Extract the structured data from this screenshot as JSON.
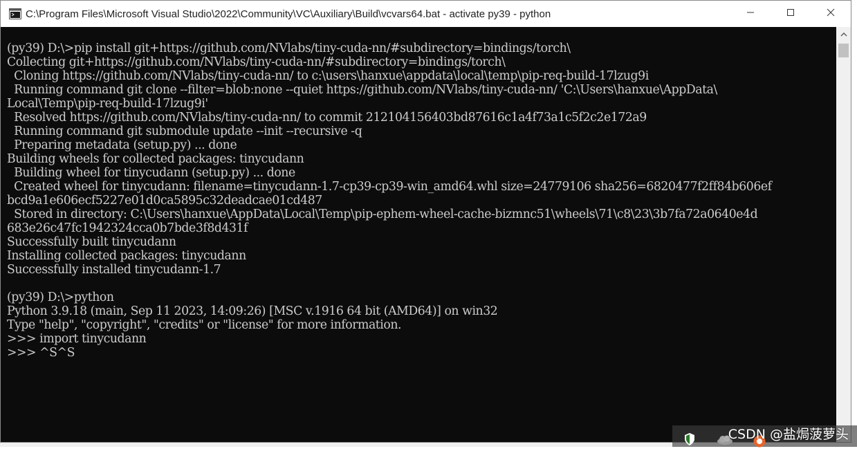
{
  "window": {
    "title": "C:\\Program Files\\Microsoft Visual Studio\\2022\\Community\\VC\\Auxiliary\\Build\\vcvars64.bat - activate  py39 - python",
    "icons": {
      "app": "console-icon",
      "minimize": "minimize-icon",
      "maximize": "maximize-icon",
      "close": "close-icon"
    }
  },
  "console": {
    "lines": [
      "(py39) D:\\>pip install git+https://github.com/NVlabs/tiny-cuda-nn/#subdirectory=bindings/torch\\",
      "Collecting git+https://github.com/NVlabs/tiny-cuda-nn/#subdirectory=bindings/torch\\",
      "  Cloning https://github.com/NVlabs/tiny-cuda-nn/ to c:\\users\\hanxue\\appdata\\local\\temp\\pip-req-build-17lzug9i",
      "  Running command git clone --filter=blob:none --quiet https://github.com/NVlabs/tiny-cuda-nn/ 'C:\\Users\\hanxue\\AppData\\",
      "Local\\Temp\\pip-req-build-17lzug9i'",
      "  Resolved https://github.com/NVlabs/tiny-cuda-nn/ to commit 212104156403bd87616c1a4f73a1c5f2c2e172a9",
      "  Running command git submodule update --init --recursive -q",
      "  Preparing metadata (setup.py) ... done",
      "Building wheels for collected packages: tinycudann",
      "  Building wheel for tinycudann (setup.py) ... done",
      "  Created wheel for tinycudann: filename=tinycudann-1.7-cp39-cp39-win_amd64.whl size=24779106 sha256=6820477f2ff84b606ef",
      "bcd9a1e606ecf5227e01d0ca5895c32deadcae01cd487",
      "  Stored in directory: C:\\Users\\hanxue\\AppData\\Local\\Temp\\pip-ephem-wheel-cache-bizmnc51\\wheels\\71\\c8\\23\\3b7fa72a0640e4d",
      "683e26c47fc1942324cca0b7bde3f8d431f",
      "Successfully built tinycudann",
      "Installing collected packages: tinycudann",
      "Successfully installed tinycudann-1.7",
      "",
      "(py39) D:\\>python",
      "Python 3.9.18 (main, Sep 11 2023, 14:09:26) [MSC v.1916 64 bit (AMD64)] on win32",
      "Type \"help\", \"copyright\", \"credits\" or \"license\" for more information.",
      ">>> import tinycudann",
      ">>> ^S^S"
    ]
  },
  "scrollbar": {
    "up_icon": "scroll-up-arrow-icon"
  },
  "tray": {
    "icons": [
      "security-shield-icon",
      "cloud-icon",
      "app-tray-icon"
    ]
  },
  "watermark": {
    "text": "CSDN @盐焗菠萝头"
  },
  "colors": {
    "console_bg": "#0c0c0c",
    "console_fg": "#cccccc",
    "titlebar_bg": "#ffffff"
  }
}
